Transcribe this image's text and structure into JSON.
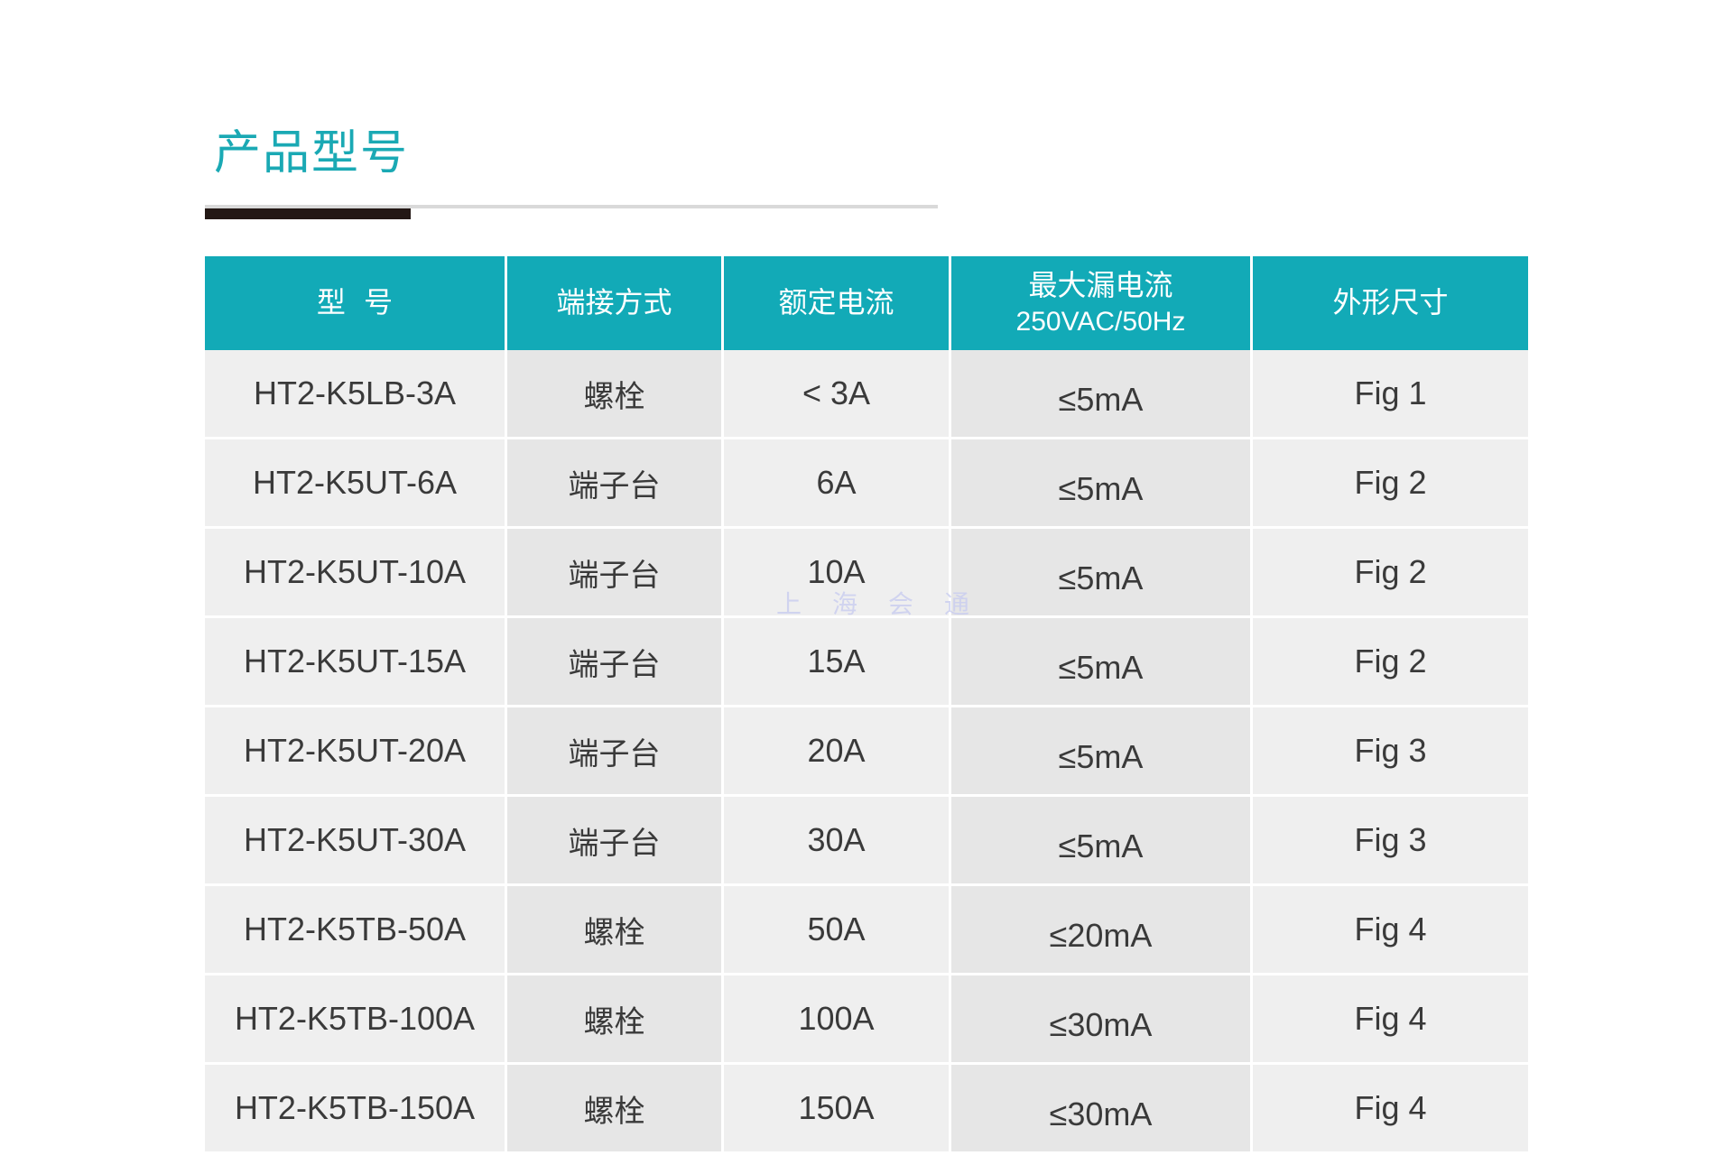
{
  "title": "产品型号",
  "table": {
    "headers": {
      "model": "型  号",
      "terminal": "端接方式",
      "rated_current": "额定电流",
      "leakage": "最大漏电流",
      "leakage_condition": "250VAC/50Hz",
      "dimension": "外形尺寸"
    },
    "rows": [
      {
        "model": "HT2-K5LB-3A",
        "terminal": "螺栓",
        "current": "< 3A",
        "leakage": "≤5mA",
        "fig": "Fig 1"
      },
      {
        "model": "HT2-K5UT-6A",
        "terminal": "端子台",
        "current": "6A",
        "leakage": "≤5mA",
        "fig": "Fig 2"
      },
      {
        "model": "HT2-K5UT-10A",
        "terminal": "端子台",
        "current": "10A",
        "leakage": "≤5mA",
        "fig": "Fig 2"
      },
      {
        "model": "HT2-K5UT-15A",
        "terminal": "端子台",
        "current": "15A",
        "leakage": "≤5mA",
        "fig": "Fig 2"
      },
      {
        "model": "HT2-K5UT-20A",
        "terminal": "端子台",
        "current": "20A",
        "leakage": "≤5mA",
        "fig": "Fig 3"
      },
      {
        "model": "HT2-K5UT-30A",
        "terminal": "端子台",
        "current": "30A",
        "leakage": "≤5mA",
        "fig": "Fig 3"
      },
      {
        "model": "HT2-K5TB-50A",
        "terminal": "螺栓",
        "current": "50A",
        "leakage": "≤20mA",
        "fig": "Fig 4"
      },
      {
        "model": "HT2-K5TB-100A",
        "terminal": "螺栓",
        "current": "100A",
        "leakage": "≤30mA",
        "fig": "Fig 4"
      },
      {
        "model": "HT2-K5TB-150A",
        "terminal": "螺栓",
        "current": "150A",
        "leakage": "≤30mA",
        "fig": "Fig 4"
      }
    ]
  },
  "watermark": "上海会通",
  "colors": {
    "accent": "#12aab7",
    "title": "#1aa9b4",
    "rule_accent": "#231815"
  }
}
